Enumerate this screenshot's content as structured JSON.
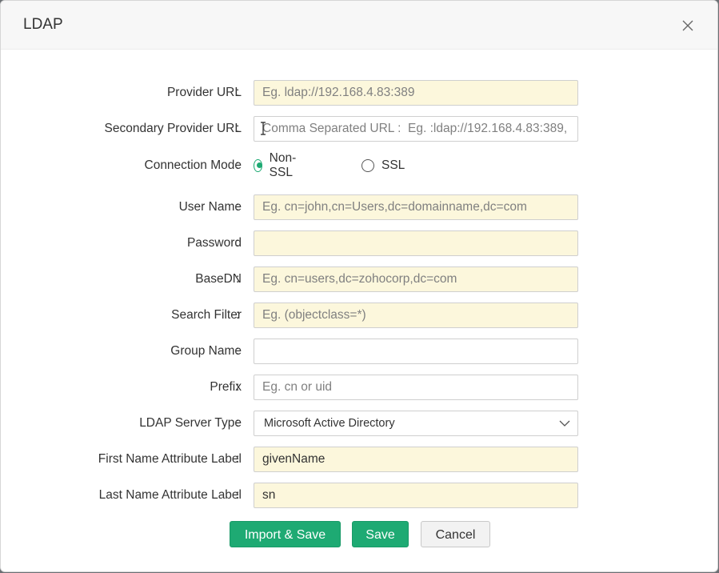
{
  "dialog": {
    "title": "LDAP"
  },
  "form": {
    "colon": ":",
    "provider_url": {
      "label": "Provider URL",
      "placeholder": "Eg. ldap://192.168.4.83:389",
      "value": ""
    },
    "secondary_provider_url": {
      "label": "Secondary Provider URL",
      "placeholder": "Comma Separated URL :  Eg. :ldap://192.168.4.83:389,",
      "value": ""
    },
    "connection_mode": {
      "label": "Connection Mode",
      "options": [
        "Non-SSL",
        "SSL"
      ],
      "selected": "Non-SSL"
    },
    "user_name": {
      "label": "User Name",
      "placeholder": "Eg. cn=john,cn=Users,dc=domainname,dc=com",
      "value": ""
    },
    "password": {
      "label": "Password",
      "placeholder": "",
      "value": ""
    },
    "base_dn": {
      "label": "BaseDN",
      "placeholder": "Eg. cn=users,dc=zohocorp,dc=com",
      "value": ""
    },
    "search_filter": {
      "label": "Search Filter",
      "placeholder": "Eg. (objectclass=*)",
      "value": ""
    },
    "group_name": {
      "label": "Group Name",
      "placeholder": "",
      "value": ""
    },
    "prefix": {
      "label": "Prefix",
      "placeholder": "Eg. cn or uid",
      "value": ""
    },
    "ldap_server_type": {
      "label": "LDAP Server Type",
      "value": "Microsoft Active Directory"
    },
    "first_name_attr": {
      "label": "First Name Attribute Label",
      "value": "givenName"
    },
    "last_name_attr": {
      "label": "Last Name Attribute Label",
      "value": "sn"
    }
  },
  "buttons": {
    "import_save": "Import & Save",
    "save": "Save",
    "cancel": "Cancel"
  },
  "colors": {
    "accent": "#1eaa73",
    "field_highlight": "#fcf7dc"
  },
  "icons": {
    "close": "close-icon",
    "dropdown": "chevron-down-icon",
    "cursor": "text-cursor-icon"
  }
}
